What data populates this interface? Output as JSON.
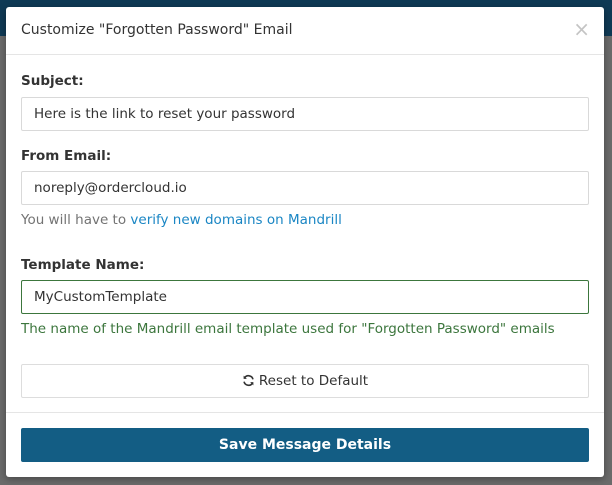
{
  "modal": {
    "title": "Customize \"Forgotten Password\" Email",
    "close_label": "×"
  },
  "subject": {
    "label": "Subject:",
    "value": "Here is the link to reset your password"
  },
  "from_email": {
    "label": "From Email:",
    "value": "noreply@ordercloud.io",
    "help_prefix": "You will have to ",
    "help_link": "verify new domains on Mandrill"
  },
  "template_name": {
    "label": "Template Name:",
    "value": "MyCustomTemplate",
    "help": "The name of the Mandrill email template used for \"Forgotten Password\" emails"
  },
  "reset_button": {
    "label": "Reset to Default",
    "icon": "refresh-icon"
  },
  "save_button": {
    "label": "Save Message Details"
  },
  "colors": {
    "primary": "#135d84",
    "link": "#1a86c4",
    "success": "#3c763d"
  }
}
